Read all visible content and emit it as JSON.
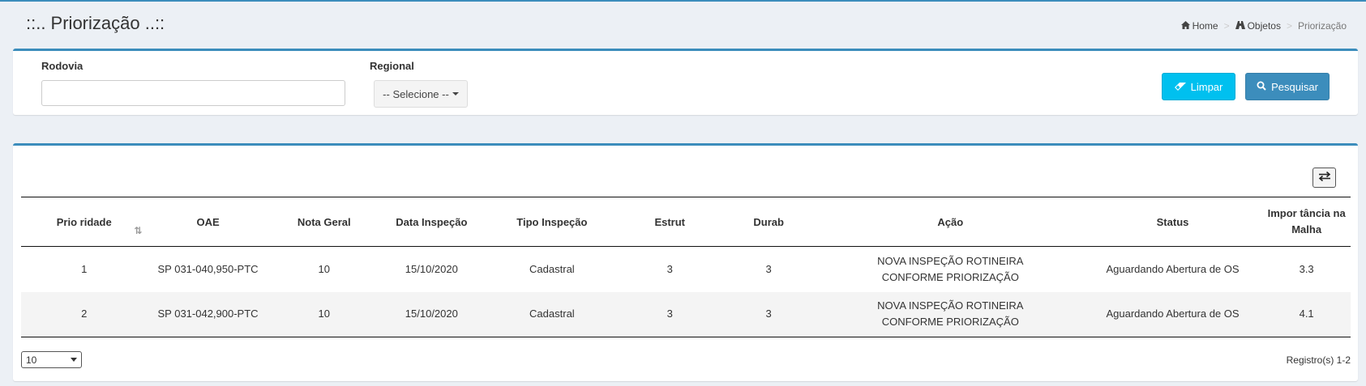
{
  "header": {
    "title": "::.. Priorização ..::",
    "breadcrumb": [
      {
        "label": "Home",
        "icon": "home-icon"
      },
      {
        "label": "Objetos",
        "icon": "bridge-icon"
      },
      {
        "label": "Priorização"
      }
    ]
  },
  "filters": {
    "rodovia_label": "Rodovia",
    "rodovia_value": "",
    "regional_label": "Regional",
    "regional_selected": "-- Selecione --",
    "clear_label": "Limpar",
    "search_label": "Pesquisar"
  },
  "table": {
    "columns": [
      "Prio ridade",
      "OAE",
      "Nota Geral",
      "Data Inspeção",
      "Tipo Inspeção",
      "Estrut",
      "Durab",
      "Ação",
      "Status",
      "Impor tância na Malha"
    ],
    "rows": [
      [
        "1",
        "SP 031-040,950-PTC",
        "10",
        "15/10/2020",
        "Cadastral",
        "3",
        "3",
        "NOVA INSPEÇÃO ROTINEIRA CONFORME PRIORIZAÇÃO",
        "Aguardando Abertura de OS",
        "3.3"
      ],
      [
        "2",
        "SP 031-042,900-PTC",
        "10",
        "15/10/2020",
        "Cadastral",
        "3",
        "3",
        "NOVA INSPEÇÃO ROTINEIRA CONFORME PRIORIZAÇÃO",
        "Aguardando Abertura de OS",
        "4.1"
      ]
    ]
  },
  "footer": {
    "page_size": "10",
    "record_count": "Registro(s) 1-2"
  },
  "colors": {
    "accent": "#3c8dbc",
    "clear_button": "#00c0ef",
    "background": "#ecf0f5"
  }
}
